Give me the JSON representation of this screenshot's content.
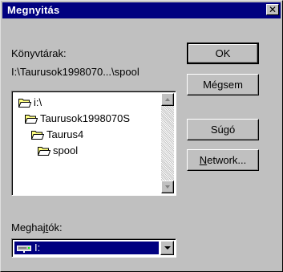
{
  "window": {
    "title": "Megnyitás",
    "close_glyph": "✕"
  },
  "directories": {
    "label": "Könyvtárak:",
    "current_path": "I:\\Taurusok1998070...\\spool",
    "items": [
      {
        "label": "i:\\",
        "icon": "open-folder-icon"
      },
      {
        "label": "Taurusok1998070S",
        "icon": "open-folder-icon"
      },
      {
        "label": "Taurus4",
        "icon": "open-folder-icon"
      },
      {
        "label": "spool",
        "icon": "open-folder-icon"
      }
    ]
  },
  "buttons": {
    "ok": "OK",
    "cancel": "Mégsem",
    "help": "Súgó",
    "network_prefix": "N",
    "network_rest": "etwork..."
  },
  "drives": {
    "label_prefix": "Meghaj",
    "label_underlined": "t",
    "label_suffix": "ók:",
    "selected": "I:",
    "icon": "network-drive-icon"
  },
  "colors": {
    "title_bar": "#000080",
    "face": "#c0c0c0",
    "selection": "#000080"
  }
}
